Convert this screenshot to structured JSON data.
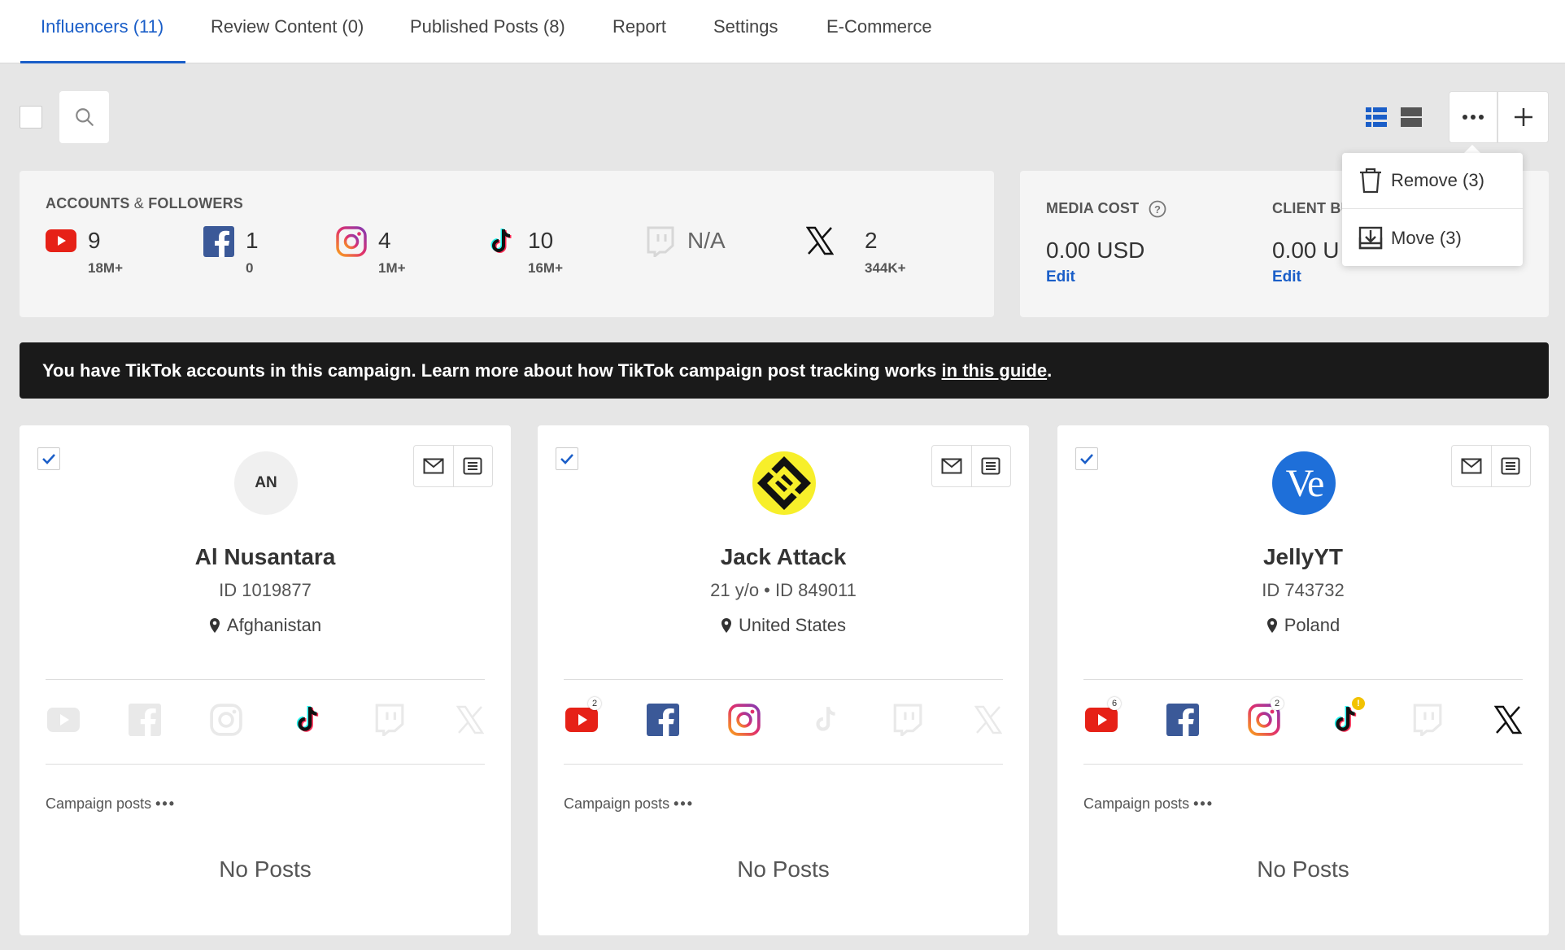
{
  "tabs": [
    {
      "label": "Influencers (11)",
      "active": true
    },
    {
      "label": "Review Content (0)"
    },
    {
      "label": "Published Posts (8)"
    },
    {
      "label": "Report"
    },
    {
      "label": "Settings"
    },
    {
      "label": "E-Commerce"
    }
  ],
  "accounts": {
    "title_a": "ACCOUNTS",
    "title_b": " & ",
    "title_c": "FOLLOWERS",
    "stats": [
      {
        "icon": "youtube-icon",
        "count": "9",
        "followers": "18M+"
      },
      {
        "icon": "facebook-icon",
        "count": "1",
        "followers": "0"
      },
      {
        "icon": "instagram-icon",
        "count": "4",
        "followers": "1M+"
      },
      {
        "icon": "tiktok-icon",
        "count": "10",
        "followers": "16M+"
      },
      {
        "icon": "twitch-icon",
        "count": "N/A",
        "followers": ""
      },
      {
        "icon": "x-icon",
        "count": "2",
        "followers": "344K+"
      }
    ]
  },
  "costs": {
    "media_label": "MEDIA COST",
    "media_value": "0.00 USD",
    "media_edit": "Edit",
    "client_label": "CLIENT BU",
    "client_value": "0.00 U",
    "client_edit": "Edit"
  },
  "dropdown": {
    "remove": "Remove (3)",
    "move": "Move (3)"
  },
  "banner": {
    "text": "You have TikTok accounts in this campaign. Learn more about how TikTok campaign post tracking works ",
    "link": "in this guide",
    "end": "."
  },
  "cards": [
    {
      "name": "Al Nusantara",
      "meta": "ID 1019877",
      "location": "Afghanistan",
      "avatar_text": "AN",
      "campaign_posts": "Campaign posts",
      "no_posts": "No Posts"
    },
    {
      "name": "Jack Attack",
      "meta": "21 y/o • ID 849011",
      "location": "United States",
      "campaign_posts": "Campaign posts",
      "no_posts": "No Posts",
      "badges": {
        "youtube": "2"
      }
    },
    {
      "name": "JellyYT",
      "meta": "ID 743732",
      "location": "Poland",
      "avatar_text": "Ve",
      "campaign_posts": "Campaign posts",
      "no_posts": "No Posts",
      "badges": {
        "youtube": "6",
        "instagram": "2",
        "tiktok": "!"
      }
    }
  ],
  "colors": {
    "accent": "#1a5ec8",
    "youtube": "#e62117",
    "facebook": "#3b5998",
    "banner_bg": "#1a1a1a"
  }
}
